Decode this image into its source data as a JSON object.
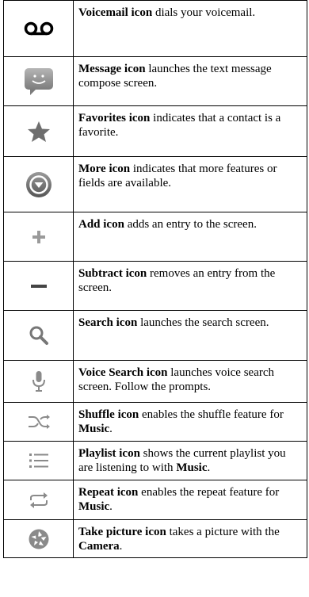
{
  "rows": [
    {
      "icon": "voicemail-icon",
      "title": "Voicemail icon",
      "desc": " dials your voicemail."
    },
    {
      "icon": "message-icon",
      "title": "Message icon",
      "desc": " launches the text message compose screen."
    },
    {
      "icon": "favorites-star-icon",
      "title": "Favorites icon",
      "desc": " indicates that a contact is a favorite."
    },
    {
      "icon": "more-icon",
      "title": "More icon",
      "desc": " indicates that more features or fields are available."
    },
    {
      "icon": "add-icon",
      "title": "Add icon",
      "desc": " adds an entry to the screen."
    },
    {
      "icon": "subtract-icon",
      "title": "Subtract icon",
      "desc": " removes an entry from the screen."
    },
    {
      "icon": "search-icon",
      "title": "Search icon",
      "desc": " launches the search screen."
    },
    {
      "icon": "voice-search-icon",
      "title": "Voice Search icon",
      "desc": " launches voice search screen. Follow the prompts."
    },
    {
      "icon": "shuffle-icon",
      "title": "Shuffle icon",
      "desc": " enables the shuffle feature for ",
      "tail_bold": "Music",
      "tail": "."
    },
    {
      "icon": "playlist-icon",
      "title": "Playlist icon",
      "desc": " shows the current playlist you are listening to with ",
      "tail_bold": "Music",
      "tail": "."
    },
    {
      "icon": "repeat-icon",
      "title": "Repeat icon",
      "desc": " enables the repeat feature for ",
      "tail_bold": "Music",
      "tail": "."
    },
    {
      "icon": "take-picture-icon",
      "title": "Take picture icon",
      "desc": " takes a picture with the ",
      "tail_bold": "Camera",
      "tail": "."
    }
  ]
}
